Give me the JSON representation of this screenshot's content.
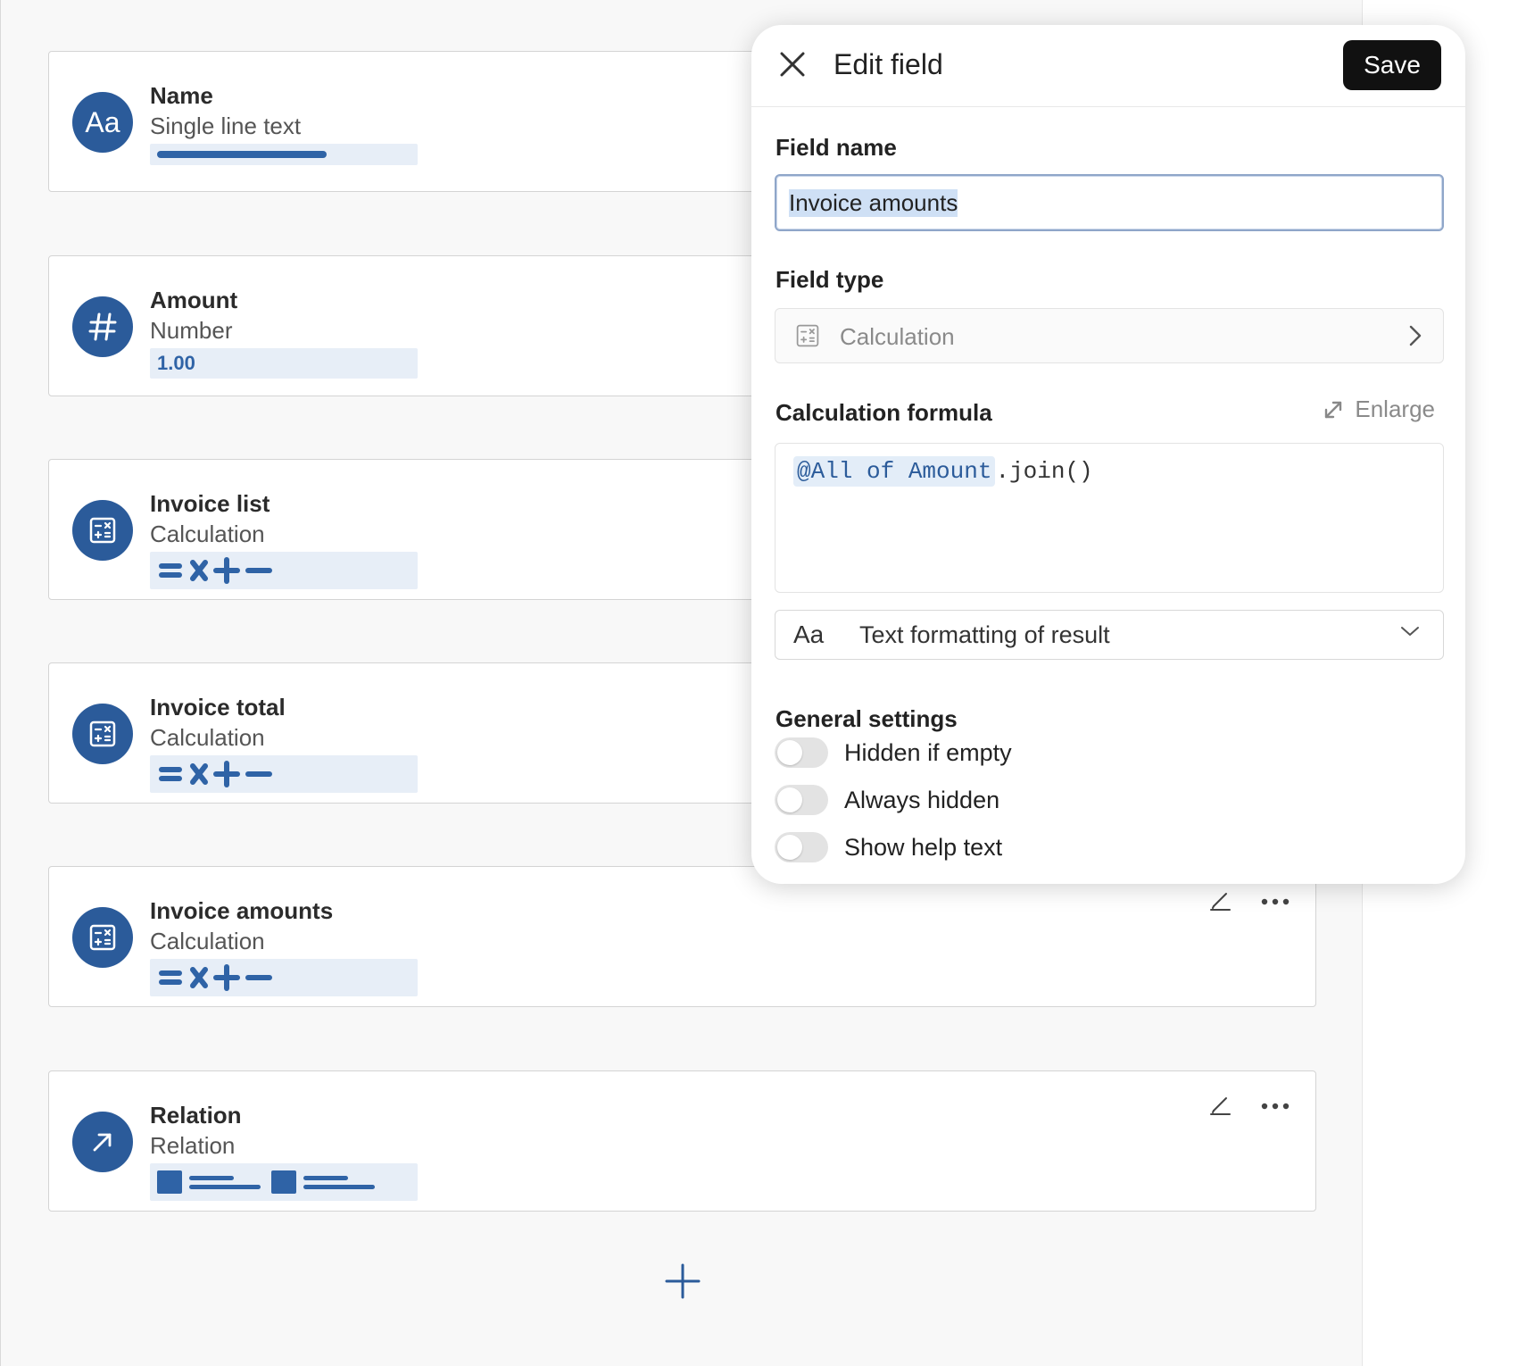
{
  "fields": [
    {
      "title": "Name",
      "type": "Single line text",
      "icon": "text-icon",
      "preview": "line"
    },
    {
      "title": "Amount",
      "type": "Number",
      "icon": "hash-icon",
      "preview": "number",
      "preview_value": "1.00"
    },
    {
      "title": "Invoice list",
      "type": "Calculation",
      "icon": "calculator-icon",
      "preview": "calc"
    },
    {
      "title": "Invoice total",
      "type": "Calculation",
      "icon": "calculator-icon",
      "preview": "calc"
    },
    {
      "title": "Invoice amounts",
      "type": "Calculation",
      "icon": "calculator-icon",
      "preview": "calc"
    },
    {
      "title": "Relation",
      "type": "Relation",
      "icon": "arrow-up-right-icon",
      "preview": "relation"
    }
  ],
  "name_icon_text": "Aa",
  "panel": {
    "title": "Edit field",
    "save_label": "Save",
    "field_name_label": "Field name",
    "field_name_value": "Invoice amounts",
    "field_type_label": "Field type",
    "field_type_value": "Calculation",
    "formula_label": "Calculation formula",
    "enlarge_label": "Enlarge",
    "formula_token": "@All of Amount",
    "formula_rest": ".join()",
    "format_prefix": "Aa",
    "format_value": "Text formatting of result",
    "general_label": "General settings",
    "toggles": [
      {
        "label": "Hidden if empty",
        "on": false
      },
      {
        "label": "Always hidden",
        "on": false
      },
      {
        "label": "Show help text",
        "on": false
      }
    ]
  },
  "colors": {
    "accent": "#2b5b9a",
    "preview_bg": "#e7eef7",
    "save_bg": "#111111"
  }
}
